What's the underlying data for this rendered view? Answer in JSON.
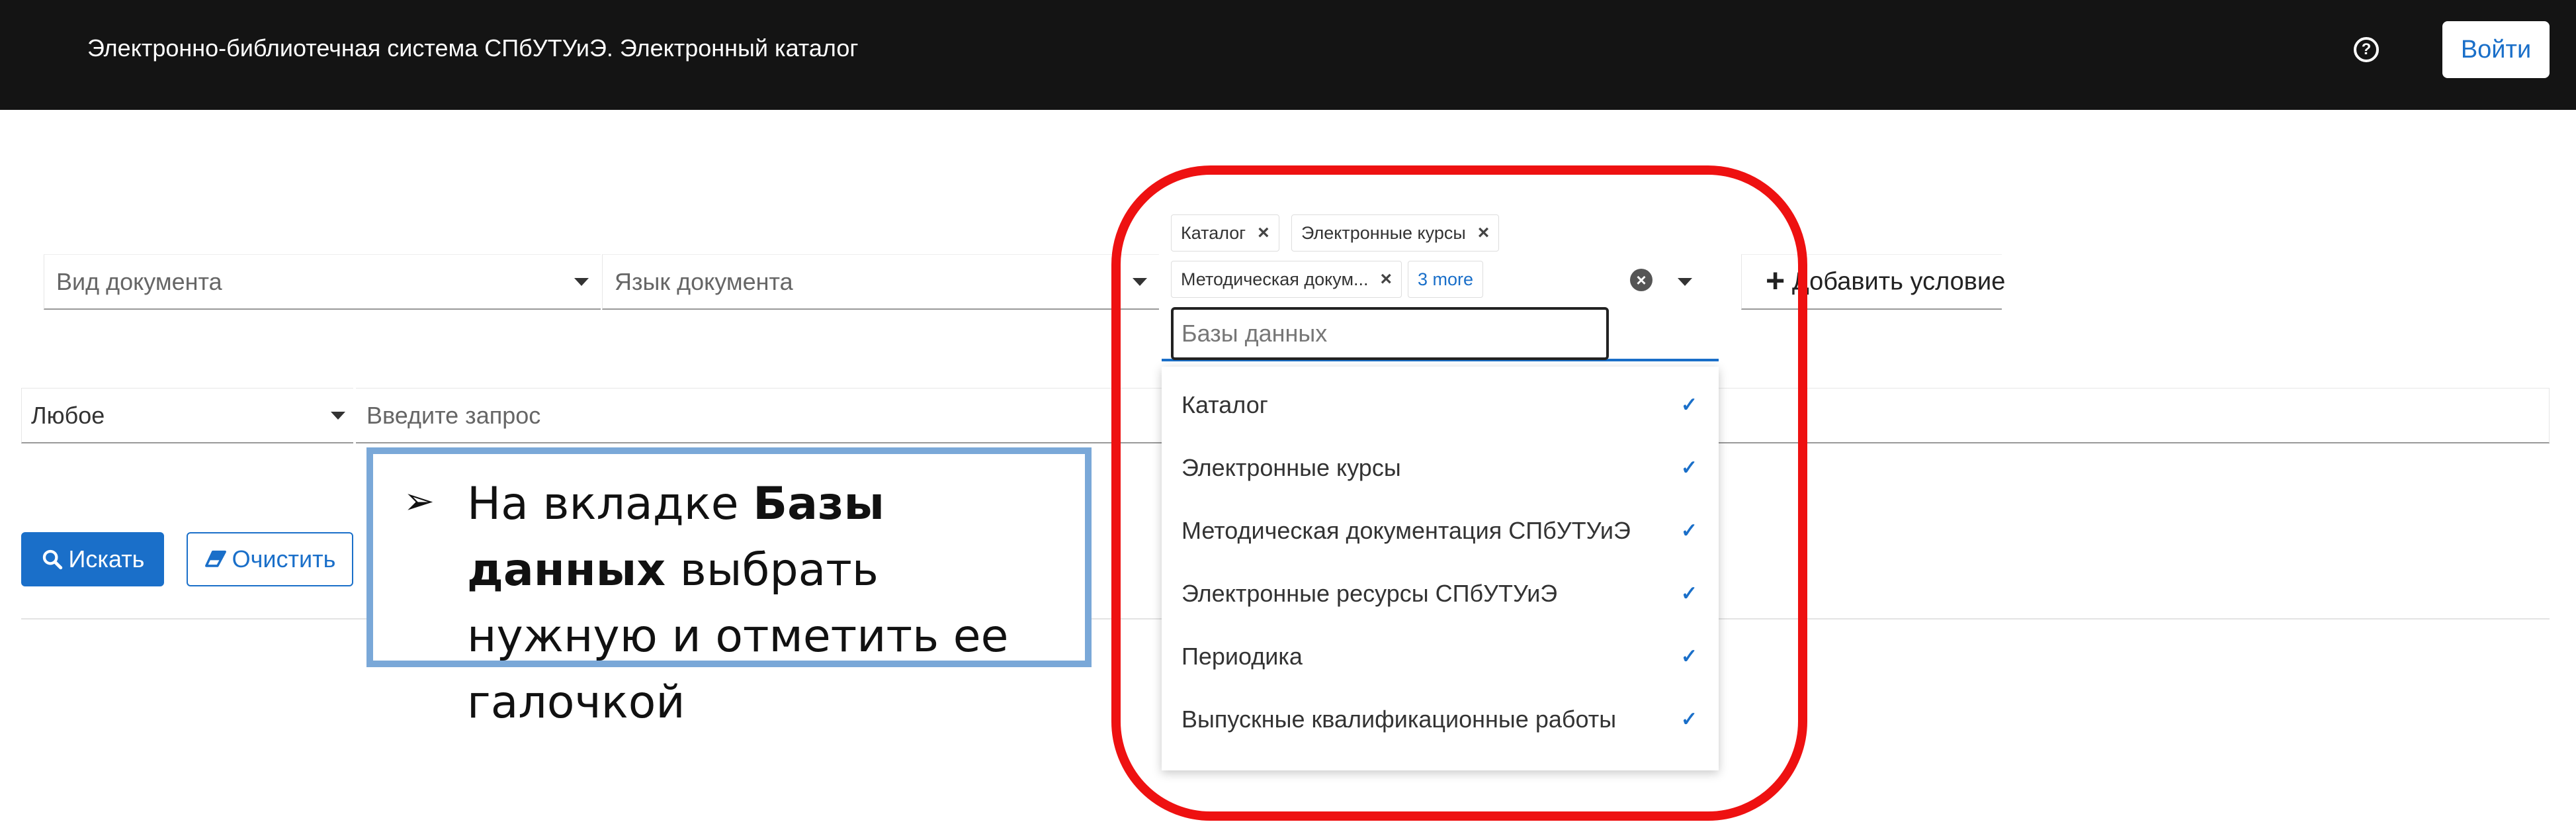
{
  "header": {
    "title": "Электронно-библиотечная система СПбУТУиЭ. Электронный каталог",
    "help_icon": "question-circle-icon",
    "login_label": "Войти"
  },
  "filters": {
    "doc_type_placeholder": "Вид документа",
    "doc_lang_placeholder": "Язык документа",
    "add_condition_label": "Добавить условие"
  },
  "databases": {
    "placeholder": "Базы данных",
    "chips": [
      {
        "label": "Каталог"
      },
      {
        "label": "Электронные курсы"
      },
      {
        "label": "Методическая докум..."
      }
    ],
    "more_label": "3 more",
    "options": [
      {
        "label": "Каталог",
        "selected": true
      },
      {
        "label": "Электронные курсы",
        "selected": true
      },
      {
        "label": "Методическая документация СПбУТУиЭ",
        "selected": true
      },
      {
        "label": "Электронные ресурсы СПбУТУиЭ",
        "selected": true
      },
      {
        "label": "Периодика",
        "selected": true
      },
      {
        "label": "Выпускные квалификационные работы",
        "selected": true
      }
    ]
  },
  "query": {
    "match_mode": "Любое",
    "placeholder": "Введите запрос"
  },
  "actions": {
    "search_label": "Искать",
    "clear_label": "Очистить"
  },
  "annotation": {
    "text_before": "На вкладке ",
    "text_bold": "Базы данных",
    "text_after": " выбрать нужную и отметить ее галочкой",
    "ring_color": "#ee1111",
    "box_border_color": "#7aa8d8"
  },
  "colors": {
    "accent": "#1a6fc9",
    "topbar": "#141414"
  }
}
